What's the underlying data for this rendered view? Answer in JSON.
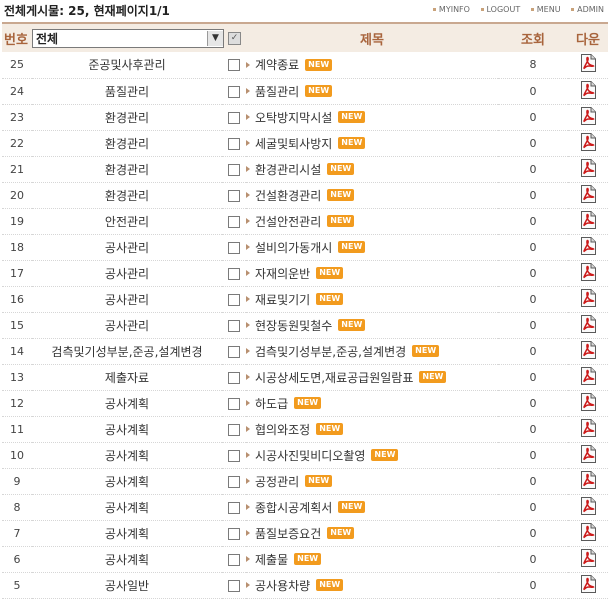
{
  "summary": "전체게시물: 25,  현재페이지1/1",
  "top_links": [
    "MYINFO",
    "LOGOUT",
    "MENU",
    "ADMIN"
  ],
  "header": {
    "no": "번호",
    "category_select": "전체",
    "title": "제목",
    "views": "조회",
    "download": "다운"
  },
  "new_badge": "NEW",
  "icons": {
    "select_arrow": "chevron-down-icon",
    "select_all": "checkbox-icon",
    "download": "pdf-file-icon"
  },
  "colors": {
    "header_text": "#a8643c",
    "header_bg": "#f4ece3",
    "new_badge": "#f29b1e",
    "pdf_red": "#cc1a1a"
  },
  "rows": [
    {
      "no": "25",
      "category": "준공및사후관리",
      "title": "계약종료",
      "views": "8"
    },
    {
      "no": "24",
      "category": "품질관리",
      "title": "품질관리",
      "views": "0"
    },
    {
      "no": "23",
      "category": "환경관리",
      "title": "오탁방지막시설",
      "views": "0"
    },
    {
      "no": "22",
      "category": "환경관리",
      "title": "세굴및퇴사방지",
      "views": "0"
    },
    {
      "no": "21",
      "category": "환경관리",
      "title": "환경관리시설",
      "views": "0"
    },
    {
      "no": "20",
      "category": "환경관리",
      "title": "건설환경관리",
      "views": "0"
    },
    {
      "no": "19",
      "category": "안전관리",
      "title": "건설안전관리",
      "views": "0"
    },
    {
      "no": "18",
      "category": "공사관리",
      "title": "설비의가동개시",
      "views": "0"
    },
    {
      "no": "17",
      "category": "공사관리",
      "title": "자재의운반",
      "views": "0"
    },
    {
      "no": "16",
      "category": "공사관리",
      "title": "재료및기기",
      "views": "0"
    },
    {
      "no": "15",
      "category": "공사관리",
      "title": "현장동원및철수",
      "views": "0"
    },
    {
      "no": "14",
      "category": "검측및기성부분,준공,설계변경",
      "title": "검측및기성부분,준공,설계변경",
      "views": "0"
    },
    {
      "no": "13",
      "category": "제출자료",
      "title": "시공상세도면,재료공급원일람표",
      "views": "0"
    },
    {
      "no": "12",
      "category": "공사계획",
      "title": "하도급",
      "views": "0"
    },
    {
      "no": "11",
      "category": "공사계획",
      "title": "협의와조정",
      "views": "0"
    },
    {
      "no": "10",
      "category": "공사계획",
      "title": "시공사진및비디오촬영",
      "views": "0"
    },
    {
      "no": "9",
      "category": "공사계획",
      "title": "공정관리",
      "views": "0"
    },
    {
      "no": "8",
      "category": "공사계획",
      "title": "종합시공계획서",
      "views": "0"
    },
    {
      "no": "7",
      "category": "공사계획",
      "title": "품질보증요건",
      "views": "0"
    },
    {
      "no": "6",
      "category": "공사계획",
      "title": "제출물",
      "views": "0"
    },
    {
      "no": "5",
      "category": "공사일반",
      "title": "공사용차량",
      "views": "0"
    }
  ]
}
